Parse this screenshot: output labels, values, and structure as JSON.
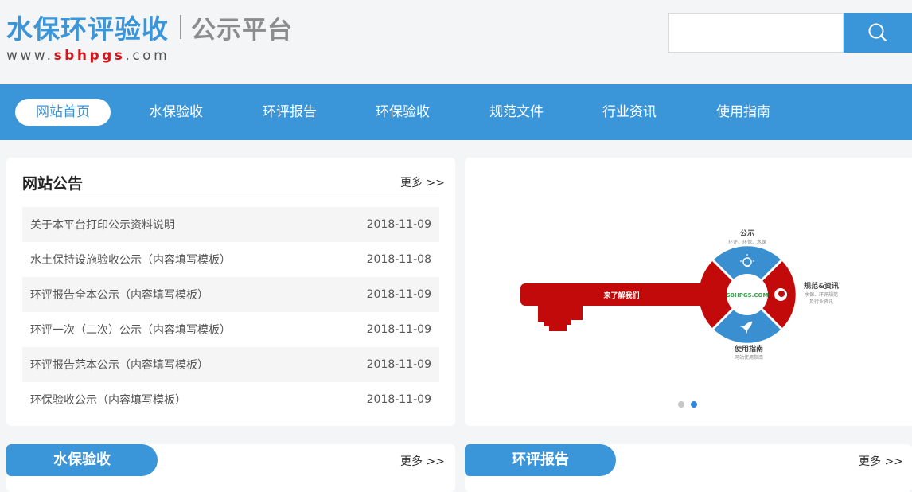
{
  "header": {
    "title": "水保环评验收",
    "subtitle": "公示平台",
    "url_prefix": "www.",
    "url_domain": "sbhpgs",
    "url_suffix": ".com",
    "search_placeholder": "",
    "search_icon": "search-icon"
  },
  "nav": {
    "items": [
      {
        "label": "网站首页",
        "active": true
      },
      {
        "label": "水保验收"
      },
      {
        "label": "环评报告"
      },
      {
        "label": "环保验收"
      },
      {
        "label": "规范文件"
      },
      {
        "label": "行业资讯"
      },
      {
        "label": "使用指南"
      }
    ]
  },
  "notice": {
    "title": "网站公告",
    "more": "更多 >>",
    "items": [
      {
        "title": "关于本平台打印公示资料说明",
        "date": "2018-11-09"
      },
      {
        "title": "水土保持设施验收公示（内容填写模板）",
        "date": "2018-11-08"
      },
      {
        "title": "环评报告全本公示（内容填写模板）",
        "date": "2018-11-09"
      },
      {
        "title": "环评一次（二次）公示（内容填写模板）",
        "date": "2018-11-09"
      },
      {
        "title": "环评报告范本公示（内容填写模板）",
        "date": "2018-11-09"
      },
      {
        "title": "环保验收公示（内容填写模板）",
        "date": "2018-11-09"
      }
    ]
  },
  "banner": {
    "key_label": "来了解我们",
    "center_label": "SBHPGS.COM",
    "top_title": "公示",
    "top_desc": "环评、环保、水保",
    "right_title": "规范&资讯",
    "right_desc1": "水保、环评规范",
    "right_desc2": "及行业资讯",
    "bottom_title": "使用指南",
    "bottom_desc": "网站使用指南",
    "colors": {
      "red": "#c20a0a",
      "blue": "#3a8fd0"
    },
    "slides": 2,
    "active_slide": 2
  },
  "sections": [
    {
      "title": "水保验收",
      "more": "更多 >>"
    },
    {
      "title": "环评报告",
      "more": "更多 >>"
    }
  ],
  "colors": {
    "brand_blue": "#3a95d9",
    "url_red": "#d9141b"
  }
}
